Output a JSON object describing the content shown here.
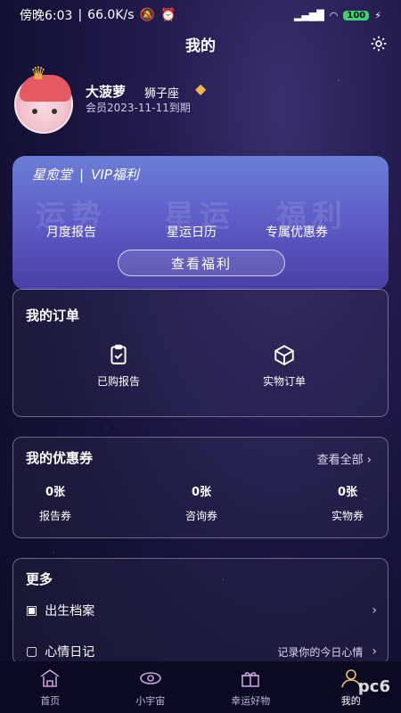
{
  "status_bar": {
    "time": "傍晚6:03",
    "speed": "66.0K/s",
    "battery": "100"
  },
  "header": {
    "title": "我的"
  },
  "profile": {
    "name": "大菠萝",
    "zodiac": "狮子座",
    "expire": "会员2023-11-11到期"
  },
  "vip": {
    "brand": "星愈堂",
    "label": "VIP福利",
    "bg_texts": [
      "运势",
      "星运",
      "福利"
    ],
    "features": [
      "月度报告",
      "星运日历",
      "专属优惠券"
    ],
    "button": "查看福利"
  },
  "orders": {
    "title": "我的订单",
    "items": [
      {
        "label": "已购报告",
        "icon": "clipboard-check-icon"
      },
      {
        "label": "实物订单",
        "icon": "package-box-icon"
      }
    ]
  },
  "coupons": {
    "title": "我的优惠券",
    "see_all": "查看全部",
    "items": [
      {
        "count": "0张",
        "label": "报告券"
      },
      {
        "count": "0张",
        "label": "咨询券"
      },
      {
        "count": "0张",
        "label": "实物券"
      }
    ]
  },
  "more": {
    "title": "更多",
    "items": [
      {
        "label": "出生档案",
        "hint": ""
      },
      {
        "label": "心情日记",
        "hint": "记录你的今日心情"
      }
    ]
  },
  "tabs": [
    {
      "label": "首页",
      "icon": "home-temple-icon"
    },
    {
      "label": "小宇宙",
      "icon": "eye-planet-icon"
    },
    {
      "label": "幸运好物",
      "icon": "gift-icon"
    },
    {
      "label": "我的",
      "icon": "profile-icon"
    }
  ],
  "watermark": "pc6"
}
